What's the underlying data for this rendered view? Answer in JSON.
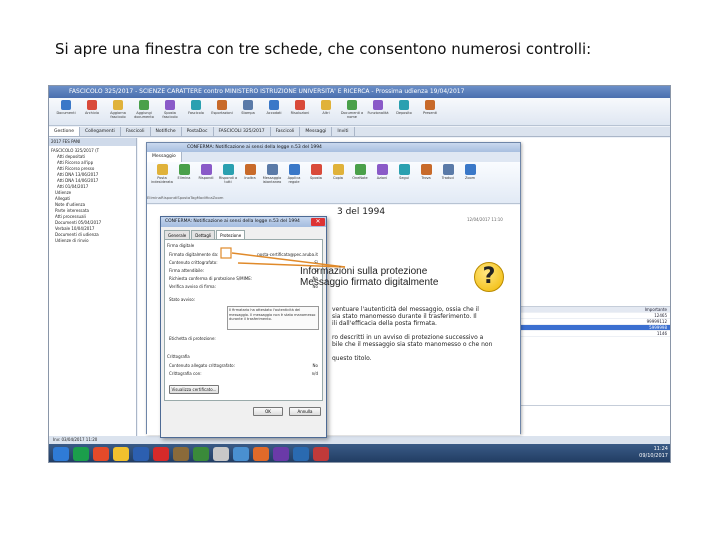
{
  "caption": "Si apre una finestra con tre schede, che consentono numerosi controlli:",
  "app": {
    "title": "FASCICOLO 325/2017 - SCIENZE CARATTERE contro MINISTERO ISTRUZIONE UNIVERSITA' E RICERCA - Prossima udienza 19/04/2017",
    "ribbon": [
      "Documenti",
      "Archivio",
      "Aggiorna fascicolo",
      "Aggiungi documento",
      "Sposta fascicolo",
      "Fascicolo",
      "Esportazioni",
      "Stampa",
      "Accodati",
      "Risoluzioni",
      "Altri",
      "Documenti a nome",
      "Funzionalità",
      "Deposito",
      "Presenti"
    ],
    "tabs": [
      "Gestione",
      "Collegamenti",
      "Fascicoli",
      "Notifiche",
      "PostaDoc",
      "FASCICOLI 325/2017",
      "Fascicoli",
      "Messaggi",
      "Inviti"
    ],
    "tree_header": "2017 FES PANI",
    "tree": [
      "FASCICOLO 325/2017 (T",
      "Atti depositati",
      "Atti Ricorso all'ipp",
      "Atti Ricorso presso",
      "Atti DNA 13/06/2017",
      "Atti DNA 14/06/2017",
      "Atti 01/04/2017",
      "Udienze",
      "Allegati",
      "Note d'udienza",
      "Parte interessata",
      "Atti processuali",
      "Documenti 05/04/2017",
      "Verbale 10/04/2017",
      "Documenti di udienza",
      "Udienze di rinvio"
    ],
    "status": "Inv: 03/04/2017 11:20",
    "grid_header": "Importante",
    "grid_rows": [
      "12465",
      "99999112",
      "5999998",
      "1146"
    ],
    "clock_time": "11:24",
    "clock_date": "09/10/2017"
  },
  "message_window": {
    "title": "CONFERMA: Notificazione ai sensi della legge n.53 del 1994",
    "tabs": [
      "Messaggio"
    ],
    "ribbon": [
      "Posta indesiderata",
      "Elimina",
      "Rispondi",
      "Rispondi a tutti",
      "Inoltra",
      "Messaggio istantaneo",
      "Applica regole",
      "Sposta",
      "Copia",
      "OneNote",
      "Azioni",
      "Segui",
      "Trova",
      "Traduci",
      "Zoom"
    ],
    "groups": [
      "Elimina",
      "Rispondi",
      "Sposta",
      "Tag",
      "Modifica",
      "Zoom"
    ],
    "subject": "3 del 1994",
    "date": "12/04/2017 11:10",
    "body_lines": [
      "ventuare l'autenticità del messaggio, ossia che il",
      "sia stato manomesso durante il trasferimento. Il",
      "ili dall'efficacia della posta firmata.",
      "",
      "ro descritti in un avviso di protezione successivo a",
      "bile che il messaggio sia stato manomesso o che non",
      "",
      "questo titolo."
    ]
  },
  "dialog": {
    "title": "CONFERMA: Notificazione ai sensi della legge n.53 del 1994",
    "tabs": [
      "Generale",
      "Dettagli",
      "Protezione"
    ],
    "section1": "Firma digitale",
    "rows": [
      {
        "label": "Firmato digitalmente da:",
        "value": "posta-certificata@pec.aruba.it"
      },
      {
        "label": "Contenuto crittografato:",
        "value": "Sì"
      },
      {
        "label": "Firma attendibile:",
        "value": "Sì"
      },
      {
        "label": "Richiesta conferma di protezione S/MIME:",
        "value": "No"
      },
      {
        "label": "Verifica avviso di firma:",
        "value": "No"
      }
    ],
    "stato_label": "Stato avviso:",
    "note": "Il firmatario ha attestato l'autenticità del messaggio. Il messaggio non è stato manomesso durante il trasferimento.",
    "etichetta_label": "Etichetta di protezione:",
    "section2": "Crittografia",
    "rows2": [
      {
        "label": "Contenuto allegato crittografato:",
        "value": "No"
      },
      {
        "label": "Crittografia con:",
        "value": "n/d"
      }
    ],
    "view_button": "Visualizza certificato...",
    "ok": "OK",
    "cancel": "Annulla"
  },
  "callout": {
    "line1": "Informazioni sulla protezione",
    "line2": "Messaggio firmato digitalmente",
    "icon": "question-icon"
  }
}
